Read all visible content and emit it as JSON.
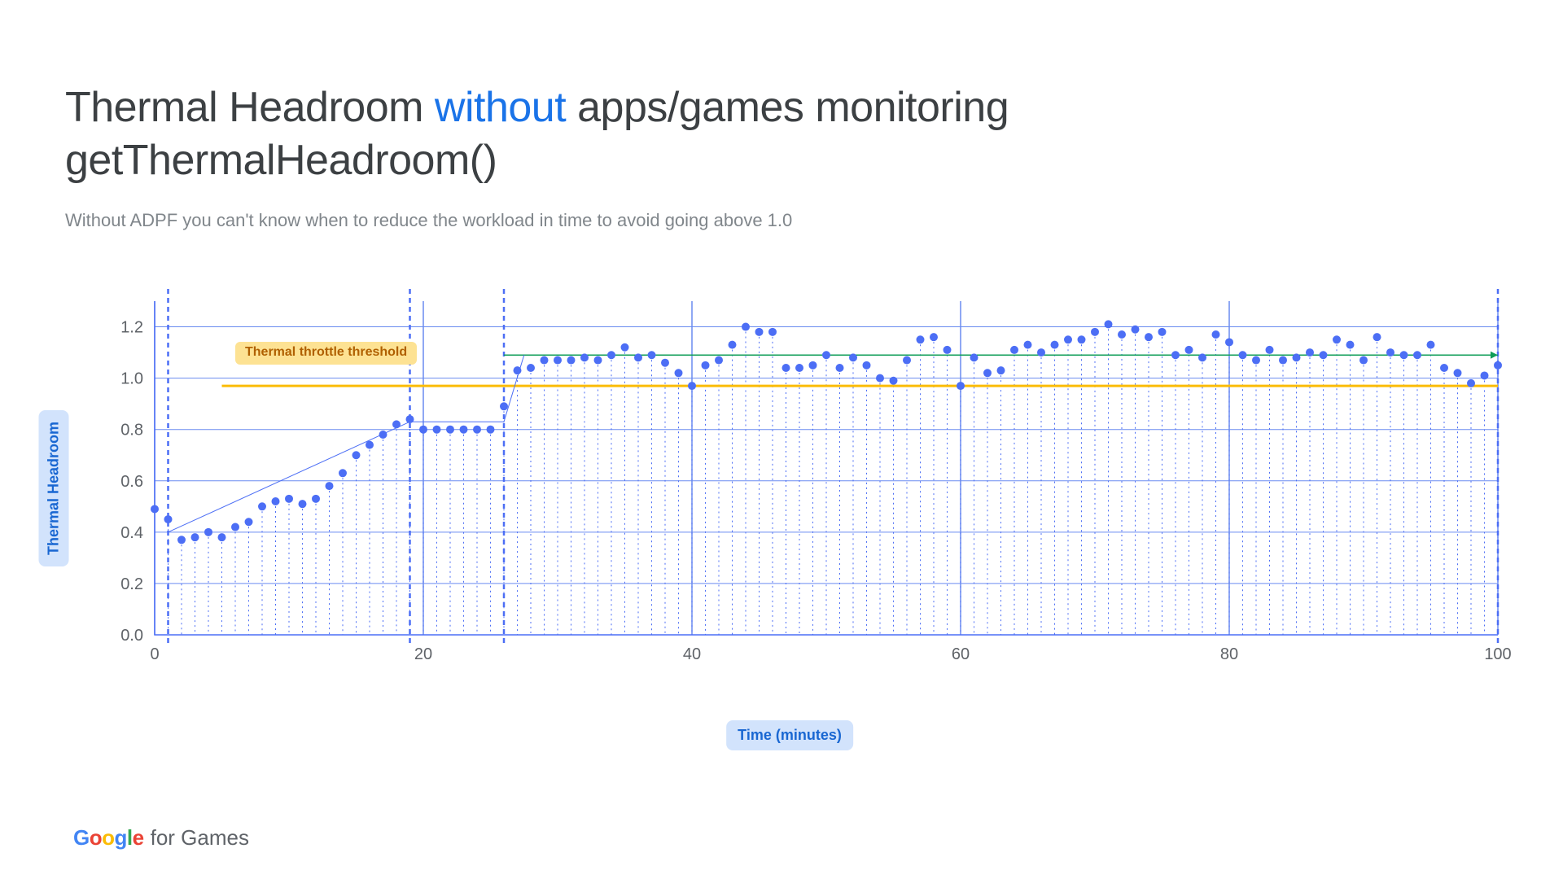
{
  "title_prefix": "Thermal Headroom ",
  "title_highlight": "without",
  "title_suffix": " apps/games monitoring getThermalHeadroom()",
  "subtitle": "Without ADPF you can't know when to reduce the workload in time to avoid going above 1.0",
  "threshold_label": "Thermal throttle threshold",
  "yaxis_label": "Thermal Headroom",
  "xaxis_label": "Time (minutes)",
  "footer_for_games": "for Games",
  "chart_data": {
    "type": "scatter",
    "xlabel": "Time (minutes)",
    "ylabel": "Thermal Headroom",
    "xlim": [
      0,
      100
    ],
    "ylim": [
      0.0,
      1.3
    ],
    "xticks": [
      0,
      20,
      40,
      60,
      80,
      100
    ],
    "yticks": [
      0.0,
      0.2,
      0.4,
      0.6,
      0.8,
      1.0,
      1.2
    ],
    "threshold_y": 0.97,
    "threshold_x_start": 5,
    "avg_line_y": 1.09,
    "avg_line_x_start": 26,
    "stage_x": [
      1,
      19,
      26,
      100
    ],
    "trend_segments": [
      {
        "x1": 1,
        "y1": 0.4,
        "x2": 19,
        "y2": 0.83
      },
      {
        "x1": 19,
        "y1": 0.83,
        "x2": 26,
        "y2": 0.83
      },
      {
        "x1": 26,
        "y1": 0.83,
        "x2": 27.5,
        "y2": 1.09
      }
    ],
    "series": [
      {
        "name": "headroom",
        "color": "#4c6ef5",
        "points": [
          {
            "x": 0,
            "y": 0.49
          },
          {
            "x": 1,
            "y": 0.45
          },
          {
            "x": 2,
            "y": 0.37
          },
          {
            "x": 3,
            "y": 0.38
          },
          {
            "x": 4,
            "y": 0.4
          },
          {
            "x": 5,
            "y": 0.38
          },
          {
            "x": 6,
            "y": 0.42
          },
          {
            "x": 7,
            "y": 0.44
          },
          {
            "x": 8,
            "y": 0.5
          },
          {
            "x": 9,
            "y": 0.52
          },
          {
            "x": 10,
            "y": 0.53
          },
          {
            "x": 11,
            "y": 0.51
          },
          {
            "x": 12,
            "y": 0.53
          },
          {
            "x": 13,
            "y": 0.58
          },
          {
            "x": 14,
            "y": 0.63
          },
          {
            "x": 15,
            "y": 0.7
          },
          {
            "x": 16,
            "y": 0.74
          },
          {
            "x": 17,
            "y": 0.78
          },
          {
            "x": 18,
            "y": 0.82
          },
          {
            "x": 19,
            "y": 0.84
          },
          {
            "x": 20,
            "y": 0.8
          },
          {
            "x": 21,
            "y": 0.8
          },
          {
            "x": 22,
            "y": 0.8
          },
          {
            "x": 23,
            "y": 0.8
          },
          {
            "x": 24,
            "y": 0.8
          },
          {
            "x": 25,
            "y": 0.8
          },
          {
            "x": 26,
            "y": 0.89
          },
          {
            "x": 27,
            "y": 1.03
          },
          {
            "x": 28,
            "y": 1.04
          },
          {
            "x": 29,
            "y": 1.07
          },
          {
            "x": 30,
            "y": 1.07
          },
          {
            "x": 31,
            "y": 1.07
          },
          {
            "x": 32,
            "y": 1.08
          },
          {
            "x": 33,
            "y": 1.07
          },
          {
            "x": 34,
            "y": 1.09
          },
          {
            "x": 35,
            "y": 1.12
          },
          {
            "x": 36,
            "y": 1.08
          },
          {
            "x": 37,
            "y": 1.09
          },
          {
            "x": 38,
            "y": 1.06
          },
          {
            "x": 39,
            "y": 1.02
          },
          {
            "x": 40,
            "y": 0.97
          },
          {
            "x": 41,
            "y": 1.05
          },
          {
            "x": 42,
            "y": 1.07
          },
          {
            "x": 43,
            "y": 1.13
          },
          {
            "x": 44,
            "y": 1.2
          },
          {
            "x": 45,
            "y": 1.18
          },
          {
            "x": 46,
            "y": 1.18
          },
          {
            "x": 47,
            "y": 1.04
          },
          {
            "x": 48,
            "y": 1.04
          },
          {
            "x": 49,
            "y": 1.05
          },
          {
            "x": 50,
            "y": 1.09
          },
          {
            "x": 51,
            "y": 1.04
          },
          {
            "x": 52,
            "y": 1.08
          },
          {
            "x": 53,
            "y": 1.05
          },
          {
            "x": 54,
            "y": 1.0
          },
          {
            "x": 55,
            "y": 0.99
          },
          {
            "x": 56,
            "y": 1.07
          },
          {
            "x": 57,
            "y": 1.15
          },
          {
            "x": 58,
            "y": 1.16
          },
          {
            "x": 59,
            "y": 1.11
          },
          {
            "x": 60,
            "y": 0.97
          },
          {
            "x": 61,
            "y": 1.08
          },
          {
            "x": 62,
            "y": 1.02
          },
          {
            "x": 63,
            "y": 1.03
          },
          {
            "x": 64,
            "y": 1.11
          },
          {
            "x": 65,
            "y": 1.13
          },
          {
            "x": 66,
            "y": 1.1
          },
          {
            "x": 67,
            "y": 1.13
          },
          {
            "x": 68,
            "y": 1.15
          },
          {
            "x": 69,
            "y": 1.15
          },
          {
            "x": 70,
            "y": 1.18
          },
          {
            "x": 71,
            "y": 1.21
          },
          {
            "x": 72,
            "y": 1.17
          },
          {
            "x": 73,
            "y": 1.19
          },
          {
            "x": 74,
            "y": 1.16
          },
          {
            "x": 75,
            "y": 1.18
          },
          {
            "x": 76,
            "y": 1.09
          },
          {
            "x": 77,
            "y": 1.11
          },
          {
            "x": 78,
            "y": 1.08
          },
          {
            "x": 79,
            "y": 1.17
          },
          {
            "x": 80,
            "y": 1.14
          },
          {
            "x": 81,
            "y": 1.09
          },
          {
            "x": 82,
            "y": 1.07
          },
          {
            "x": 83,
            "y": 1.11
          },
          {
            "x": 84,
            "y": 1.07
          },
          {
            "x": 85,
            "y": 1.08
          },
          {
            "x": 86,
            "y": 1.1
          },
          {
            "x": 87,
            "y": 1.09
          },
          {
            "x": 88,
            "y": 1.15
          },
          {
            "x": 89,
            "y": 1.13
          },
          {
            "x": 90,
            "y": 1.07
          },
          {
            "x": 91,
            "y": 1.16
          },
          {
            "x": 92,
            "y": 1.1
          },
          {
            "x": 93,
            "y": 1.09
          },
          {
            "x": 94,
            "y": 1.09
          },
          {
            "x": 95,
            "y": 1.13
          },
          {
            "x": 96,
            "y": 1.04
          },
          {
            "x": 97,
            "y": 1.02
          },
          {
            "x": 98,
            "y": 0.98
          },
          {
            "x": 99,
            "y": 1.01
          },
          {
            "x": 100,
            "y": 1.05
          }
        ]
      }
    ]
  }
}
